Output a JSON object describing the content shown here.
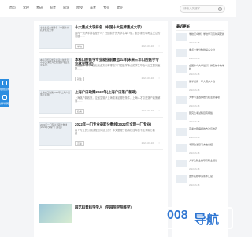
{
  "nav": {
    "items": [
      "首页",
      "学校",
      "考研",
      "报考",
      "留学",
      "院校",
      "高考",
      "专业",
      "就业"
    ],
    "search_placeholder": "请输入关键字"
  },
  "float": {
    "labels": [
      "在线咨询",
      "资料领取"
    ]
  },
  "feed": [
    {
      "thumb_alt": "十大重点大学排名（中国十大名牌重点大学）",
      "title": "十大重点大学排名（中国十大名牌重点大学）",
      "desc": "国内一流大学排名是什么？全国前十的大学名单介绍，很多家长和考生关注的问题……",
      "tag": "学校",
      "date": "2022-07-10",
      "views": "○"
    },
    {
      "thumb_alt": "本科口腔医学专业就业前景怎么样(未来三年口腔医学专业就业情况)",
      "title": "本科口腔医学专业就业前景怎么样(未来三年口腔医学专业就业情况)",
      "desc": "口腔医学本科毕业后就业方向有哪些？口腔医学专业的学生毕业以后主要到医院……",
      "tag": "就业",
      "date": "2022-07-10",
      "views": "○"
    },
    {
      "thumb_alt": "上海户口政策2022年(上海户口落户新政)",
      "title": "上海户口政策2022年(上海户口落户新政)",
      "desc": "上海落户新政策，应届生落户上海需满足哪些条件，上海人才引进落户政策解读……",
      "tag": "政策",
      "date": "2022-07-10",
      "views": "○"
    },
    {
      "thumb_alt": "2022年一门专业录取分数线(2022年文理一门专业)",
      "title": "2022年一门专业录取分数线(2022年文理一门专业)",
      "desc": "各个专业的分数线是如何划分的？本文整理了各高校往年的专业录取分数线……",
      "tag": "高考",
      "date": "2022-07-10",
      "views": "○"
    }
  ],
  "banner": {
    "title": "园艺科普科学学人（学园院学院等学）"
  },
  "sidebar": {
    "title": "最近更新",
    "items": [
      {
        "text": "学校怎么样？学校学习与时间安排",
        "date": "2022-06-18"
      },
      {
        "text": "重点大学分数线是多少分",
        "date": "2022-06-18"
      },
      {
        "text": "全国什么大学最好？排名前十的学校",
        "date": "2022-06-18"
      },
      {
        "text": "留学费用一年大概多少钱",
        "date": "2022-06-18"
      },
      {
        "text": "大学专业选择技巧和注意事项",
        "date": "2022-06-18"
      },
      {
        "text": "研究生考试科目有哪些",
        "date": "2022-06-18"
      },
      {
        "text": "高考志愿填报的方法与技巧",
        "date": "2022-06-18"
      },
      {
        "text": "考研政治复习方法总结",
        "date": "2022-06-18"
      },
      {
        "text": "大学生就业指导与职业规划",
        "date": "2022-06-18"
      },
      {
        "text": "国外名校申请条件汇总",
        "date": "2022-06-18"
      }
    ]
  },
  "watermark": {
    "num": "008",
    "cn": "导航"
  }
}
